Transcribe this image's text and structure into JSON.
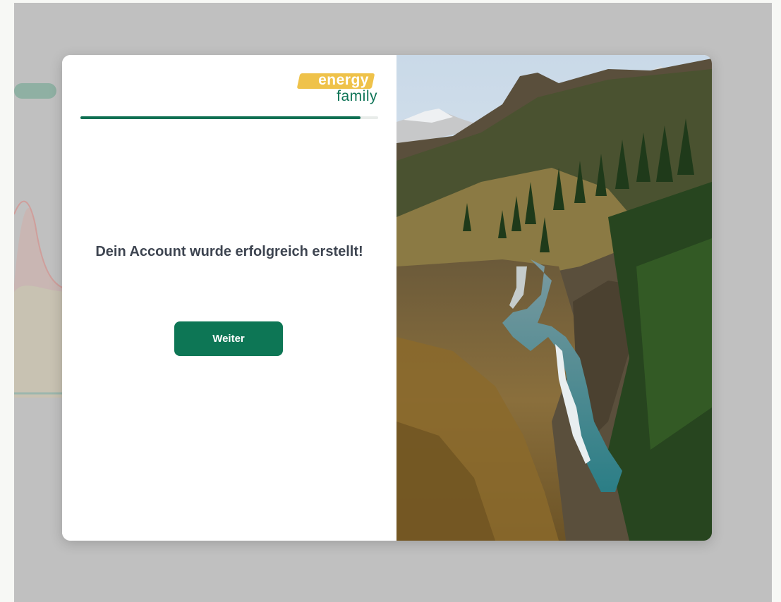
{
  "logo": {
    "line1": "energy",
    "line2": "family"
  },
  "progress": {
    "value": 0.94
  },
  "message": {
    "text": "Dein Account wurde erfolgreich erstellt!"
  },
  "continue_button": {
    "label": "Weiter"
  },
  "colors": {
    "brand_green": "#0d7655",
    "brand_yellow": "#efc24a",
    "text": "#3d4450",
    "overlay": "#c0c0c0"
  },
  "image": {
    "icon": "mountain-landscape-photo"
  }
}
